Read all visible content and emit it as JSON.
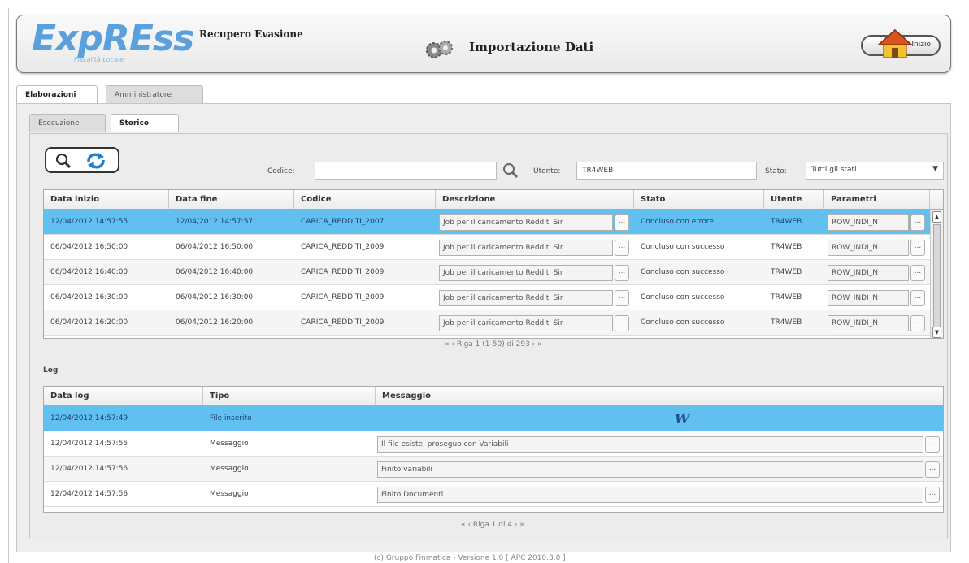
{
  "header": {
    "logo": "ExpREss",
    "logo_sub": "Fiscalità Locale",
    "app_subtitle": "Recupero Evasione",
    "page_title": "Importazione Dati",
    "home_label": "Inizio"
  },
  "tabs": {
    "main": [
      {
        "label": "Elaborazioni",
        "active": true
      },
      {
        "label": "Amministratore",
        "active": false
      }
    ],
    "sub": [
      {
        "label": "Esecuzione",
        "active": false
      },
      {
        "label": "Storico",
        "active": true
      }
    ]
  },
  "filters": {
    "codice_label": "Codice:",
    "codice_value": "",
    "utente_label": "Utente:",
    "utente_value": "TR4WEB",
    "stato_label": "Stato:",
    "stato_value": "Tutti gli stati"
  },
  "jobs": {
    "columns": [
      "Data inizio",
      "Data fine",
      "Codice",
      "Descrizione",
      "Stato",
      "Utente",
      "Parametri"
    ],
    "rows": [
      {
        "start": "12/04/2012 14:57:55",
        "end": "12/04/2012 14:57:57",
        "code": "CARICA_REDDITI_2007",
        "desc": "Job per il caricamento Redditi Sir",
        "state": "Concluso con errore",
        "user": "TR4WEB",
        "params": "ROW_INDI_N"
      },
      {
        "start": "06/04/2012 16:50:00",
        "end": "06/04/2012 16:50:00",
        "code": "CARICA_REDDITI_2009",
        "desc": "Job per il caricamento Redditi Sir",
        "state": "Concluso con successo",
        "user": "TR4WEB",
        "params": "ROW_INDI_N"
      },
      {
        "start": "06/04/2012 16:40:00",
        "end": "06/04/2012 16:40:00",
        "code": "CARICA_REDDITI_2009",
        "desc": "Job per il caricamento Redditi Sir",
        "state": "Concluso con successo",
        "user": "TR4WEB",
        "params": "ROW_INDI_N"
      },
      {
        "start": "06/04/2012 16:30:00",
        "end": "06/04/2012 16:30:00",
        "code": "CARICA_REDDITI_2009",
        "desc": "Job per il caricamento Redditi Sir",
        "state": "Concluso con successo",
        "user": "TR4WEB",
        "params": "ROW_INDI_N"
      },
      {
        "start": "06/04/2012 16:20:00",
        "end": "06/04/2012 16:20:00",
        "code": "CARICA_REDDITI_2009",
        "desc": "Job per il caricamento Redditi Sir",
        "state": "Concluso con successo",
        "user": "TR4WEB",
        "params": "ROW_INDI_N"
      }
    ],
    "pager": "«   ‹   Riga 1 (1-50) di 293   ›   »"
  },
  "log": {
    "label": "Log",
    "columns": [
      "Data log",
      "Tipo",
      "Messaggio"
    ],
    "rows": [
      {
        "date": "12/04/2012 14:57:49",
        "type": "File inserito",
        "msg": ""
      },
      {
        "date": "12/04/2012 14:57:55",
        "type": "Messaggio",
        "msg": "Il file esiste, proseguo con Variabili"
      },
      {
        "date": "12/04/2012 14:57:56",
        "type": "Messaggio",
        "msg": "Finito variabili"
      },
      {
        "date": "12/04/2012 14:57:56",
        "type": "Messaggio",
        "msg": "Finito Documenti"
      }
    ],
    "pager": "«   ‹   Riga 1 di 4   ›   »"
  },
  "footer": "(c) Gruppo Finmatica - Versione 1.0  [ APC 2010.3.0 ]",
  "colors": {
    "selection": "#62c0f0",
    "logo": "#5aa0dc"
  }
}
